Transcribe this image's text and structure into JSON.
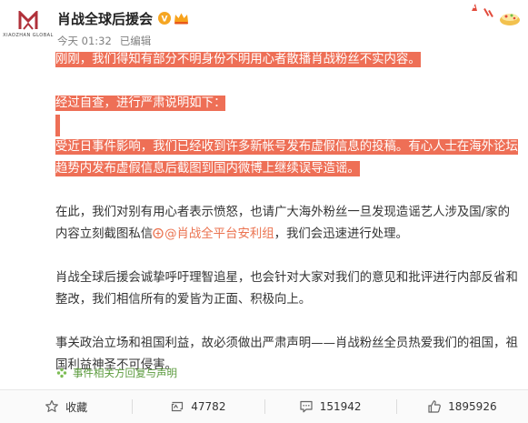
{
  "author": {
    "name": "肖战全球后援会",
    "avatar_logo_text": "XIAOZHAN GLOBAL"
  },
  "meta": {
    "time": "今天 01:32",
    "edited": "已编辑"
  },
  "paragraphs": {
    "p1": "刚刚，我们得知有部分不明身份不明用心者散播肖战粉丝不实内容。",
    "p2": "经过自查，进行严肃说明如下：",
    "p3": "受近日事件影响，我们已经收到许多新帐号发布虚假信息的投稿。有心人士在海外论坛趋势内发布虚假信息后截图到国内微博上继续误导造谣。",
    "p4_before": "在此，我们对别有用心者表示愤怒，也请广大海外粉丝一旦发现造谣艺人涉及国/家的内容立刻截图私信",
    "p4_mention": "@肖战全平台安利组",
    "p4_after": "，我们会迅速进行处理。",
    "p5": "肖战全球后援会诚挚呼吁理智追星，也会针对大家对我们的意见和批评进行内部反省和整改，我们相信所有的爱皆为正面、积极向上。",
    "p6": "事关政治立场和祖国利益，故必须做出严肃声明——肖战粉丝全员热爱我们的祖国，祖国利益神圣不可侵害。"
  },
  "topic_link": "事件相关方回复与声明",
  "actions": {
    "favorite": "收藏",
    "repost_count": "47782",
    "comment_count": "151942",
    "like_count": "1895926"
  },
  "colors": {
    "highlight": "#ee6f56",
    "mention": "#eb7350",
    "topic": "#5a9a3c"
  }
}
